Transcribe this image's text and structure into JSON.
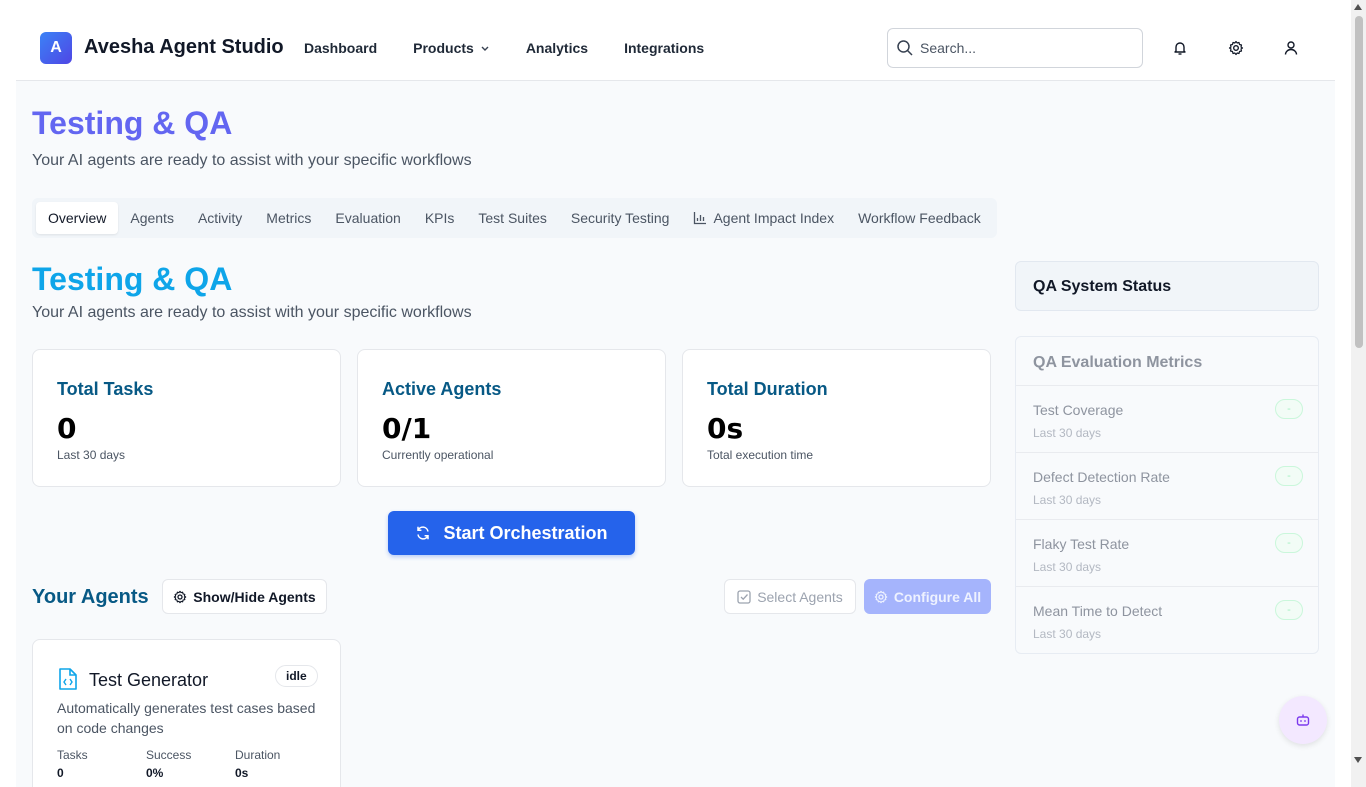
{
  "brand": {
    "logo_letter": "A",
    "name": "Avesha Agent Studio"
  },
  "nav": {
    "dashboard": "Dashboard",
    "products": "Products",
    "analytics": "Analytics",
    "integrations": "Integrations"
  },
  "search": {
    "placeholder": "Search..."
  },
  "page": {
    "title": "Testing & QA",
    "subtitle": "Your AI agents are ready to assist with your specific workflows"
  },
  "tabs": [
    {
      "label": "Overview",
      "active": true
    },
    {
      "label": "Agents"
    },
    {
      "label": "Activity"
    },
    {
      "label": "Metrics"
    },
    {
      "label": "Evaluation"
    },
    {
      "label": "KPIs"
    },
    {
      "label": "Test Suites"
    },
    {
      "label": "Security Testing"
    },
    {
      "label": "Agent Impact Index",
      "icon": "bar-chart-icon"
    },
    {
      "label": "Workflow Feedback"
    }
  ],
  "section": {
    "title": "Testing & QA",
    "subtitle": "Your AI agents are ready to assist with your specific workflows"
  },
  "stats": [
    {
      "label": "Total Tasks",
      "value": "0",
      "note": "Last 30 days"
    },
    {
      "label": "Active Agents",
      "value": "0/1",
      "note": "Currently operational"
    },
    {
      "label": "Total Duration",
      "value": "0s",
      "note": "Total execution time"
    }
  ],
  "actions": {
    "start": "Start Orchestration",
    "show_hide": "Show/Hide Agents",
    "select": "Select Agents",
    "configure": "Configure All"
  },
  "agents_title": "Your Agents",
  "agent": {
    "name": "Test Generator",
    "status": "idle",
    "description": "Automatically generates test cases based on code changes",
    "metrics": [
      {
        "label": "Tasks",
        "value": "0"
      },
      {
        "label": "Success",
        "value": "0%"
      },
      {
        "label": "Duration",
        "value": "0s"
      }
    ]
  },
  "sidebar": {
    "status_title": "QA System Status",
    "metrics_title": "QA Evaluation Metrics",
    "metrics": [
      {
        "name": "Test Coverage",
        "period": "Last 30 days",
        "value": "-"
      },
      {
        "name": "Defect Detection Rate",
        "period": "Last 30 days",
        "value": "-"
      },
      {
        "name": "Flaky Test Rate",
        "period": "Last 30 days",
        "value": "-"
      },
      {
        "name": "Mean Time to Detect",
        "period": "Last 30 days",
        "value": "-"
      }
    ]
  },
  "colors": {
    "accent": "#2563eb",
    "title_purple": "#6366f1",
    "title_blue": "#0ea5e9",
    "dark_blue": "#075985"
  }
}
